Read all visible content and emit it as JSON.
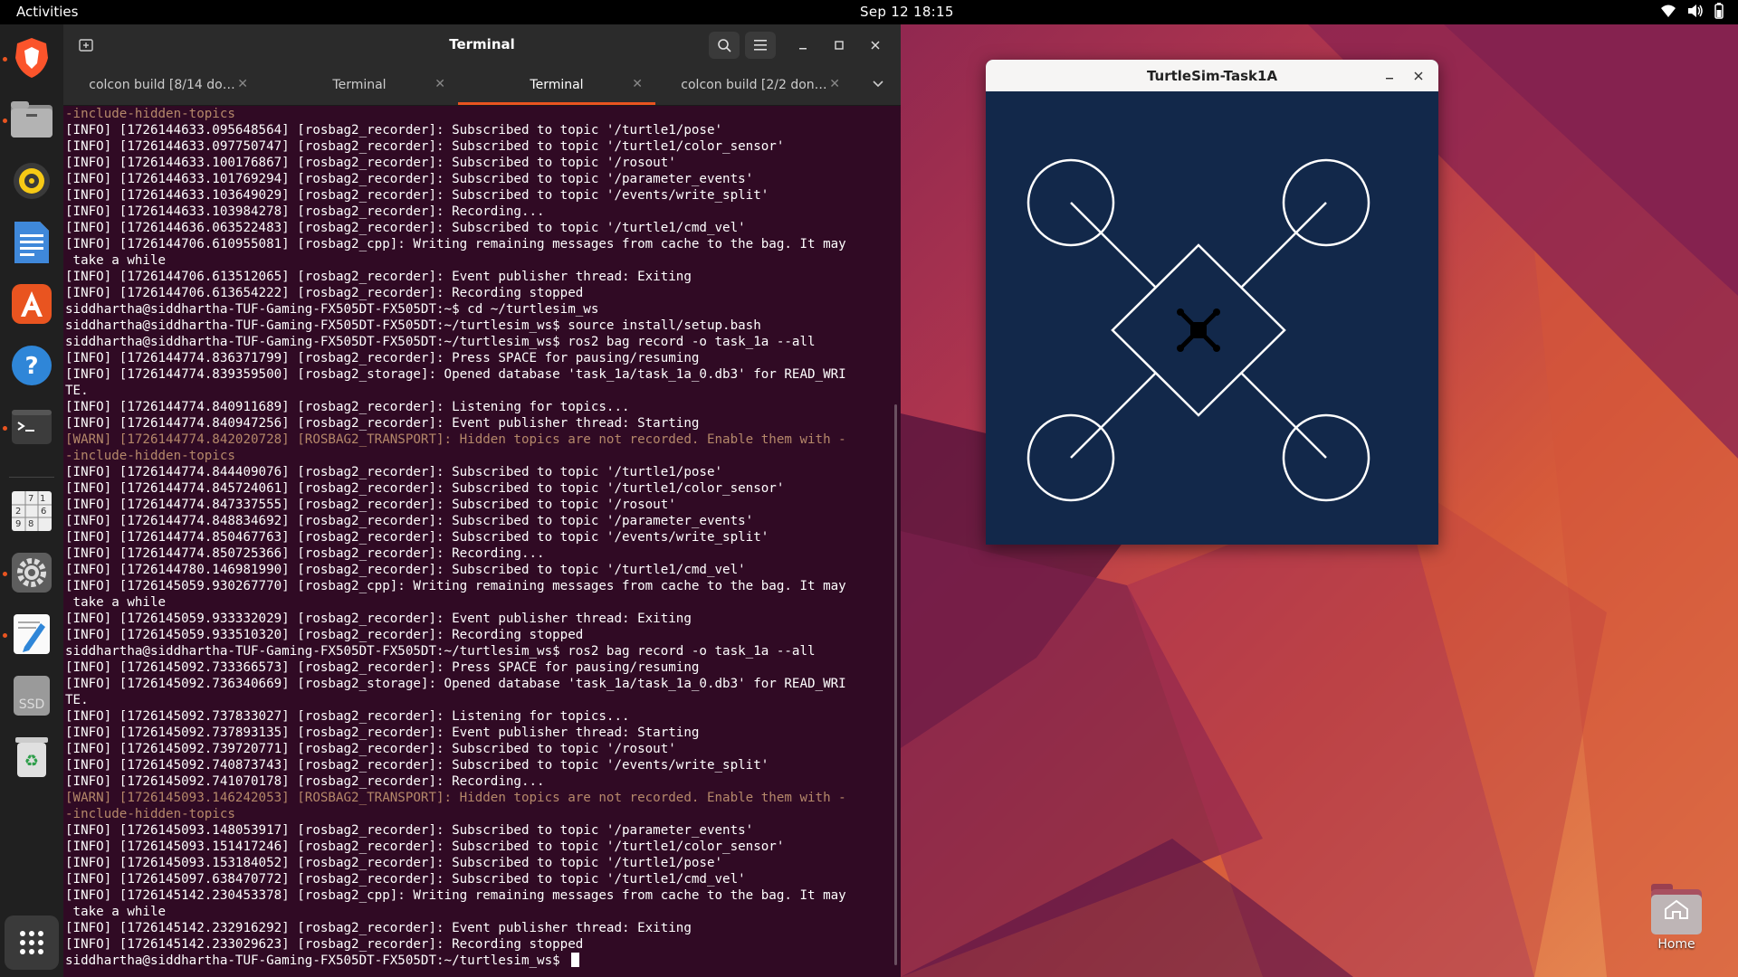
{
  "topbar": {
    "activities": "Activities",
    "clock": "Sep 12  18:15"
  },
  "dock": {
    "items": [
      {
        "name": "brave-browser-icon"
      },
      {
        "name": "files-icon"
      },
      {
        "name": "rhythmbox-icon"
      },
      {
        "name": "libreoffice-writer-icon"
      },
      {
        "name": "app-center-icon"
      },
      {
        "name": "help-icon"
      },
      {
        "name": "terminal-icon"
      },
      {
        "name": "sudoku-icon"
      },
      {
        "name": "settings-icon"
      },
      {
        "name": "text-editor-icon"
      },
      {
        "name": "ssd-drive-icon"
      },
      {
        "name": "trash-icon"
      }
    ],
    "ssd_label": "SSD",
    "sudoku_digits": [
      "7",
      "1",
      "2",
      "6",
      "9",
      "8"
    ]
  },
  "terminal": {
    "title": "Terminal",
    "tabs": [
      {
        "label": "colcon build [8/14 do…"
      },
      {
        "label": "Terminal"
      },
      {
        "label": "Terminal"
      },
      {
        "label": "colcon build [2/2 don…"
      }
    ],
    "lines": [
      {
        "t": "-include-hidden-topics",
        "w": true
      },
      {
        "t": "[INFO] [1726144633.095648564] [rosbag2_recorder]: Subscribed to topic '/turtle1/pose'"
      },
      {
        "t": "[INFO] [1726144633.097750747] [rosbag2_recorder]: Subscribed to topic '/turtle1/color_sensor'"
      },
      {
        "t": "[INFO] [1726144633.100176867] [rosbag2_recorder]: Subscribed to topic '/rosout'"
      },
      {
        "t": "[INFO] [1726144633.101769294] [rosbag2_recorder]: Subscribed to topic '/parameter_events'"
      },
      {
        "t": "[INFO] [1726144633.103649029] [rosbag2_recorder]: Subscribed to topic '/events/write_split'"
      },
      {
        "t": "[INFO] [1726144633.103984278] [rosbag2_recorder]: Recording..."
      },
      {
        "t": "[INFO] [1726144636.063522483] [rosbag2_recorder]: Subscribed to topic '/turtle1/cmd_vel'"
      },
      {
        "t": "[INFO] [1726144706.610955081] [rosbag2_cpp]: Writing remaining messages from cache to the bag. It may"
      },
      {
        "t": " take a while"
      },
      {
        "t": "[INFO] [1726144706.613512065] [rosbag2_recorder]: Event publisher thread: Exiting"
      },
      {
        "t": "[INFO] [1726144706.613654222] [rosbag2_recorder]: Recording stopped"
      },
      {
        "t": "siddhartha@siddhartha-TUF-Gaming-FX505DT-FX505DT:~$ cd ~/turtlesim_ws"
      },
      {
        "t": "siddhartha@siddhartha-TUF-Gaming-FX505DT-FX505DT:~/turtlesim_ws$ source install/setup.bash"
      },
      {
        "t": "siddhartha@siddhartha-TUF-Gaming-FX505DT-FX505DT:~/turtlesim_ws$ ros2 bag record -o task_1a --all"
      },
      {
        "t": "[INFO] [1726144774.836371799] [rosbag2_recorder]: Press SPACE for pausing/resuming"
      },
      {
        "t": "[INFO] [1726144774.839359500] [rosbag2_storage]: Opened database 'task_1a/task_1a_0.db3' for READ_WRI"
      },
      {
        "t": "TE."
      },
      {
        "t": "[INFO] [1726144774.840911689] [rosbag2_recorder]: Listening for topics..."
      },
      {
        "t": "[INFO] [1726144774.840947256] [rosbag2_recorder]: Event publisher thread: Starting"
      },
      {
        "t": "[WARN] [1726144774.842020728] [ROSBAG2_TRANSPORT]: Hidden topics are not recorded. Enable them with -",
        "w": true
      },
      {
        "t": "-include-hidden-topics",
        "w": true
      },
      {
        "t": "[INFO] [1726144774.844409076] [rosbag2_recorder]: Subscribed to topic '/turtle1/pose'"
      },
      {
        "t": "[INFO] [1726144774.845724061] [rosbag2_recorder]: Subscribed to topic '/turtle1/color_sensor'"
      },
      {
        "t": "[INFO] [1726144774.847337555] [rosbag2_recorder]: Subscribed to topic '/rosout'"
      },
      {
        "t": "[INFO] [1726144774.848834692] [rosbag2_recorder]: Subscribed to topic '/parameter_events'"
      },
      {
        "t": "[INFO] [1726144774.850467763] [rosbag2_recorder]: Subscribed to topic '/events/write_split'"
      },
      {
        "t": "[INFO] [1726144774.850725366] [rosbag2_recorder]: Recording..."
      },
      {
        "t": "[INFO] [1726144780.146981990] [rosbag2_recorder]: Subscribed to topic '/turtle1/cmd_vel'"
      },
      {
        "t": "[INFO] [1726145059.930267770] [rosbag2_cpp]: Writing remaining messages from cache to the bag. It may"
      },
      {
        "t": " take a while"
      },
      {
        "t": "[INFO] [1726145059.933332029] [rosbag2_recorder]: Event publisher thread: Exiting"
      },
      {
        "t": "[INFO] [1726145059.933510320] [rosbag2_recorder]: Recording stopped"
      },
      {
        "t": "siddhartha@siddhartha-TUF-Gaming-FX505DT-FX505DT:~/turtlesim_ws$ ros2 bag record -o task_1a --all"
      },
      {
        "t": "[INFO] [1726145092.733366573] [rosbag2_recorder]: Press SPACE for pausing/resuming"
      },
      {
        "t": "[INFO] [1726145092.736340669] [rosbag2_storage]: Opened database 'task_1a/task_1a_0.db3' for READ_WRI"
      },
      {
        "t": "TE."
      },
      {
        "t": "[INFO] [1726145092.737833027] [rosbag2_recorder]: Listening for topics..."
      },
      {
        "t": "[INFO] [1726145092.737893135] [rosbag2_recorder]: Event publisher thread: Starting"
      },
      {
        "t": "[INFO] [1726145092.739720771] [rosbag2_recorder]: Subscribed to topic '/rosout'"
      },
      {
        "t": "[INFO] [1726145092.740873743] [rosbag2_recorder]: Subscribed to topic '/events/write_split'"
      },
      {
        "t": "[INFO] [1726145092.741070178] [rosbag2_recorder]: Recording..."
      },
      {
        "t": "[WARN] [1726145093.146242053] [ROSBAG2_TRANSPORT]: Hidden topics are not recorded. Enable them with -",
        "w": true
      },
      {
        "t": "-include-hidden-topics",
        "w": true
      },
      {
        "t": "[INFO] [1726145093.148053917] [rosbag2_recorder]: Subscribed to topic '/parameter_events'"
      },
      {
        "t": "[INFO] [1726145093.151417246] [rosbag2_recorder]: Subscribed to topic '/turtle1/color_sensor'"
      },
      {
        "t": "[INFO] [1726145093.153184052] [rosbag2_recorder]: Subscribed to topic '/turtle1/pose'"
      },
      {
        "t": "[INFO] [1726145097.638470772] [rosbag2_recorder]: Subscribed to topic '/turtle1/cmd_vel'"
      },
      {
        "t": "[INFO] [1726145142.230453378] [rosbag2_cpp]: Writing remaining messages from cache to the bag. It may"
      },
      {
        "t": " take a while"
      },
      {
        "t": "[INFO] [1726145142.232916292] [rosbag2_recorder]: Event publisher thread: Exiting"
      },
      {
        "t": "[INFO] [1726145142.233029623] [rosbag2_recorder]: Recording stopped"
      }
    ],
    "prompt": "siddhartha@siddhartha-TUF-Gaming-FX505DT-FX505DT:~/turtlesim_ws$ "
  },
  "turtlesim": {
    "title": "TurtleSim-Task1A",
    "background_color": "#12284a",
    "line_color": "#ffffff"
  },
  "desktop": {
    "home_label": "Home"
  }
}
